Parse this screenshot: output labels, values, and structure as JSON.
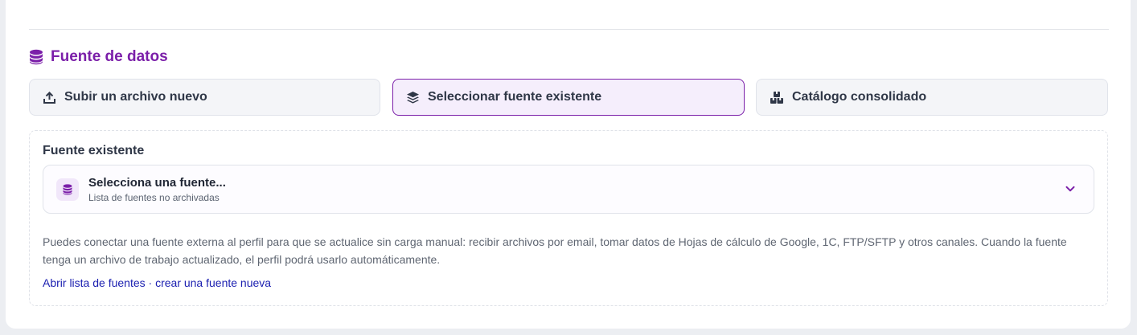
{
  "section": {
    "title": "Fuente de datos",
    "icon": "database-icon",
    "accent": "#7b1fa9"
  },
  "options": [
    {
      "label": "Subir un archivo nuevo",
      "icon": "upload-icon",
      "active": false
    },
    {
      "label": "Seleccionar fuente existente",
      "icon": "layers-icon",
      "active": true
    },
    {
      "label": "Catálogo consolidado",
      "icon": "boxes-icon",
      "active": false
    }
  ],
  "source_field": {
    "label": "Fuente existente",
    "select_title": "Selecciona una fuente...",
    "select_subtitle": "Lista de fuentes no archivadas",
    "icon": "database-icon",
    "chevron": "chevron-down-icon"
  },
  "help": {
    "text": "Puedes conectar una fuente externa al perfil para que se actualice sin carga manual: recibir archivos por email, tomar datos de Hojas de cálculo de Google, 1C, FTP/SFTP y otros canales. Cuando la fuente tenga un archivo de trabajo actualizado, el perfil podrá usarlo automáticamente."
  },
  "links": {
    "open_list": "Abrir lista de fuentes",
    "separator": " · ",
    "create_new": "crear una fuente nueva",
    "color": "#1b1fb0"
  }
}
